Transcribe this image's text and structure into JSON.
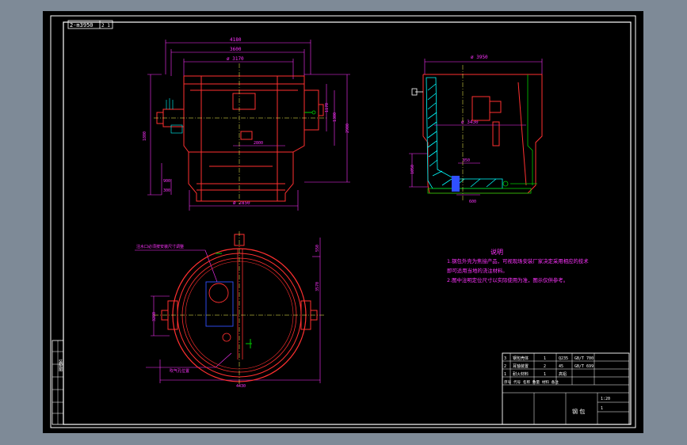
{
  "drawing": {
    "code_tag": "2-m3950",
    "code_tag_suffix": "2 1"
  },
  "colors": {
    "background": "#000000",
    "border": "#ffffff",
    "outline": "#ff3030",
    "dimension": "#ff33ff",
    "centerline": "#ffff55",
    "hatch": "#00ffff",
    "detail": "#00cc00",
    "note_text": "#ff33ff"
  },
  "front_view": {
    "dims": {
      "overall_width": "4180",
      "upper_width": "3600",
      "inner_width": "ø 3170",
      "mid_width": "2800",
      "bottom_width": "ø 2850",
      "height_left": "1800",
      "height_right_1": "1170",
      "height_right_2": "1300",
      "height_right_3": "2900",
      "lower_1": "900",
      "lower_2": "300"
    }
  },
  "section_view": {
    "dims": {
      "top_width": "ø 3950",
      "inner_dia": "ø 3430",
      "base_height": "1050",
      "base_width": "850",
      "base_sub": "600"
    }
  },
  "plan_view": {
    "dims": {
      "overall": "4430",
      "side_1": "550",
      "side_2": "3570",
      "left_height": "3280"
    },
    "callouts": {
      "upper": "注水口必须按安装尺寸调整",
      "lower": "吹气孔位置"
    }
  },
  "notes": {
    "title": "说明",
    "items": [
      "1.钢包外壳为焦接产品，可视现场安装厂家决定采用相应的技术",
      "  即可适用当地的浇注材料。",
      "2.图中注明定位尺寸以实际使用为准，图示仅供参考。"
    ]
  },
  "title_block": {
    "drawing_name": "钢 包",
    "scale": "1:20",
    "sheet": "1",
    "parts": [
      {
        "no": "3",
        "name": "钢包壳体",
        "qty": "1",
        "material": "Q235",
        "spec": "GB/T 700"
      },
      {
        "no": "2",
        "name": "耳轴装置",
        "qty": "2",
        "material": "45",
        "spec": "GB/T 699"
      },
      {
        "no": "1",
        "name": "耐火材料",
        "qty": "1",
        "material": "高铝",
        "spec": ""
      }
    ],
    "header_row": "序号  代号  名称  数量  材料  备注"
  },
  "side_strip": {
    "label": "装配图"
  }
}
